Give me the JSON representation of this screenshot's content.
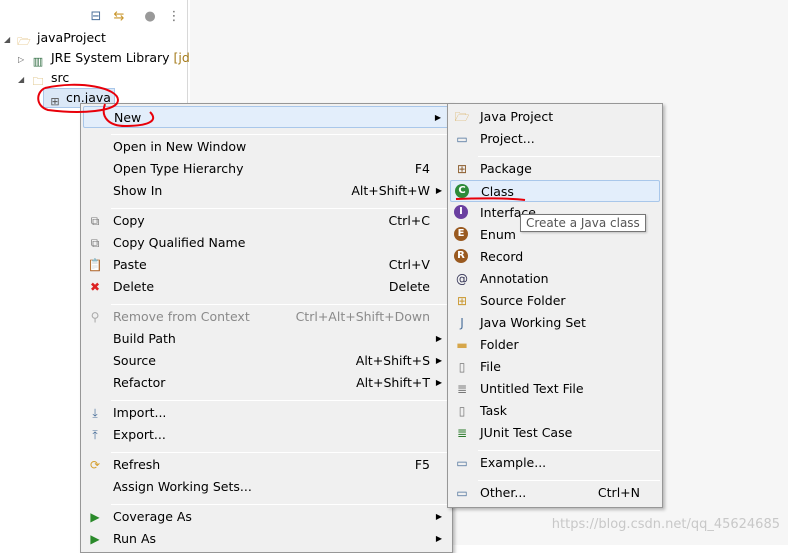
{
  "tree": {
    "toolbar": [
      "collapse-all-icon",
      "link-editor-icon",
      "filters-icon",
      "view-menu-icon"
    ],
    "items": [
      {
        "label": "javaProject",
        "icon": "project-folder-icon",
        "expanded": true
      },
      {
        "label": "JRE System Library",
        "suffix": "[jdk",
        "icon": "library-icon",
        "expanded": false
      },
      {
        "label": "src",
        "icon": "source-folder-icon",
        "expanded": true
      },
      {
        "label": "cn.java",
        "icon": "package-icon",
        "selected": true
      }
    ]
  },
  "context_menu": {
    "items": [
      {
        "label": "New",
        "submenu": true,
        "highlight": true
      },
      "sep",
      {
        "label": "Open in New Window"
      },
      {
        "label": "Open Type Hierarchy",
        "shortcut": "F4"
      },
      {
        "label": "Show In",
        "shortcut": "Alt+Shift+W",
        "submenu": true
      },
      "sep",
      {
        "label": "Copy",
        "shortcut": "Ctrl+C",
        "icon": "copy-icon"
      },
      {
        "label": "Copy Qualified Name",
        "icon": "copy-qualified-icon"
      },
      {
        "label": "Paste",
        "shortcut": "Ctrl+V",
        "icon": "paste-icon"
      },
      {
        "label": "Delete",
        "shortcut": "Delete",
        "icon": "delete-icon"
      },
      "sep",
      {
        "label": "Remove from Context",
        "shortcut": "Ctrl+Alt+Shift+Down",
        "icon": "remove-context-icon",
        "disabled": true
      },
      {
        "label": "Build Path",
        "submenu": true
      },
      {
        "label": "Source",
        "shortcut": "Alt+Shift+S",
        "submenu": true
      },
      {
        "label": "Refactor",
        "shortcut": "Alt+Shift+T",
        "submenu": true
      },
      "sep",
      {
        "label": "Import...",
        "icon": "import-icon"
      },
      {
        "label": "Export...",
        "icon": "export-icon"
      },
      "sep",
      {
        "label": "Refresh",
        "shortcut": "F5",
        "icon": "refresh-icon"
      },
      {
        "label": "Assign Working Sets..."
      },
      "sep",
      {
        "label": "Coverage As",
        "icon": "coverage-icon",
        "submenu": true
      },
      {
        "label": "Run As",
        "icon": "run-icon",
        "submenu": true
      }
    ]
  },
  "new_submenu": {
    "items": [
      {
        "label": "Java Project",
        "icon": "java-project-icon"
      },
      {
        "label": "Project...",
        "icon": "project-icon"
      },
      "sep",
      {
        "label": "Package",
        "icon": "package-icon"
      },
      {
        "label": "Class",
        "icon": "class-icon",
        "highlight": true
      },
      {
        "label": "Interface",
        "icon": "interface-icon"
      },
      {
        "label": "Enum",
        "icon": "enum-icon"
      },
      {
        "label": "Record",
        "icon": "record-icon"
      },
      {
        "label": "Annotation",
        "icon": "annotation-icon"
      },
      {
        "label": "Source Folder",
        "icon": "source-folder-icon"
      },
      {
        "label": "Java Working Set",
        "icon": "working-set-icon"
      },
      {
        "label": "Folder",
        "icon": "folder-icon"
      },
      {
        "label": "File",
        "icon": "file-icon"
      },
      {
        "label": "Untitled Text File",
        "icon": "text-file-icon"
      },
      {
        "label": "Task",
        "icon": "task-icon"
      },
      {
        "label": "JUnit Test Case",
        "icon": "junit-icon"
      },
      "sep",
      {
        "label": "Example...",
        "icon": "example-icon"
      },
      "sep",
      {
        "label": "Other...",
        "shortcut": "Ctrl+N",
        "icon": "other-icon"
      }
    ]
  },
  "tooltip": "Create a Java class",
  "watermark": "https://blog.csdn.net/qq_45624685",
  "colors": {
    "highlight": "#e3eefb",
    "annotation": "#e8000a"
  }
}
